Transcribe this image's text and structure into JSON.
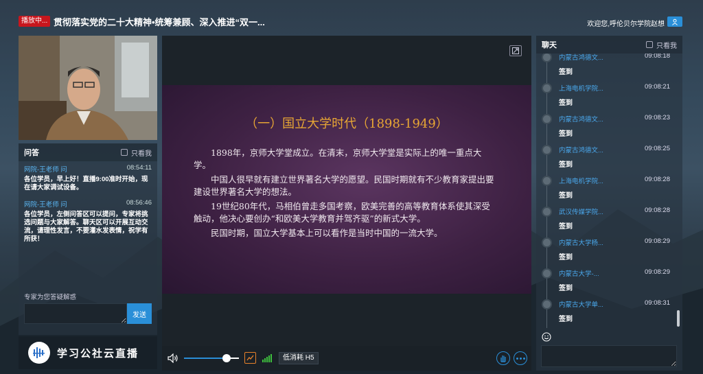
{
  "header": {
    "live_badge": "播放中...",
    "title": "贯彻落实党的二十大精神•统筹兼顾、深入推进“双一...",
    "welcome": "欢迎您,呼伦贝尔学院赵想"
  },
  "qa": {
    "title": "问答",
    "only_me": "只看我",
    "messages": [
      {
        "author": "网院-王老师 问",
        "time": "08:54:11",
        "text": "各位学员，早上好！直播9:00准时开始，现在请大家调试设备。"
      },
      {
        "author": "网院-王老师 问",
        "time": "08:56:46",
        "text": "各位学员，左侧问答区可以提问，专家将挑选问题与大家解答。聊天区可以开展互动交流，请理性发言，不要灌水发表情，祝学有所获！"
      }
    ],
    "hint": "专家为您答疑解惑",
    "send_label": "发送"
  },
  "logo": {
    "text": "学习公社云直播"
  },
  "slide": {
    "title": "（一）国立大学时代（1898-1949）",
    "paragraphs": [
      "1898年，京师大学堂成立。在清末，京师大学堂是实际上的唯一重点大学。",
      "中国人很早就有建立世界著名大学的愿望。民国时期就有不少教育家提出要建设世界著名大学的想法。",
      "19世纪80年代，马相伯曾走多国考察，欧美完善的高等教育体系使其深受触动，他决心要创办“和欧美大学教育并驾齐驱”的新式大学。",
      "民国时期，国立大学基本上可以看作是当时中国的一流大学。"
    ]
  },
  "controls": {
    "quality": "低消耗 H5",
    "volume_fraction": 0.7
  },
  "chat": {
    "title": "聊天",
    "only_me": "只看我",
    "messages": [
      {
        "name": "内蒙古鸿德文...",
        "time": "09:08:18",
        "text": "签到"
      },
      {
        "name": "上海电机学院...",
        "time": "09:08:21",
        "text": "签到"
      },
      {
        "name": "内蒙古鸿德文...",
        "time": "09:08:23",
        "text": "签到"
      },
      {
        "name": "内蒙古鸿德文...",
        "time": "09:08:25",
        "text": "签到"
      },
      {
        "name": "上海电机学院...",
        "time": "09:08:28",
        "text": "签到"
      },
      {
        "name": "武汉传媒学院...",
        "time": "09:08:28",
        "text": "签到"
      },
      {
        "name": "内蒙古大学杨...",
        "time": "09:08:29",
        "text": "签到"
      },
      {
        "name": "内蒙古大学-...",
        "time": "09:08:29",
        "text": "签到"
      },
      {
        "name": "内蒙古大学单...",
        "time": "09:08:31",
        "text": "签到"
      }
    ]
  }
}
